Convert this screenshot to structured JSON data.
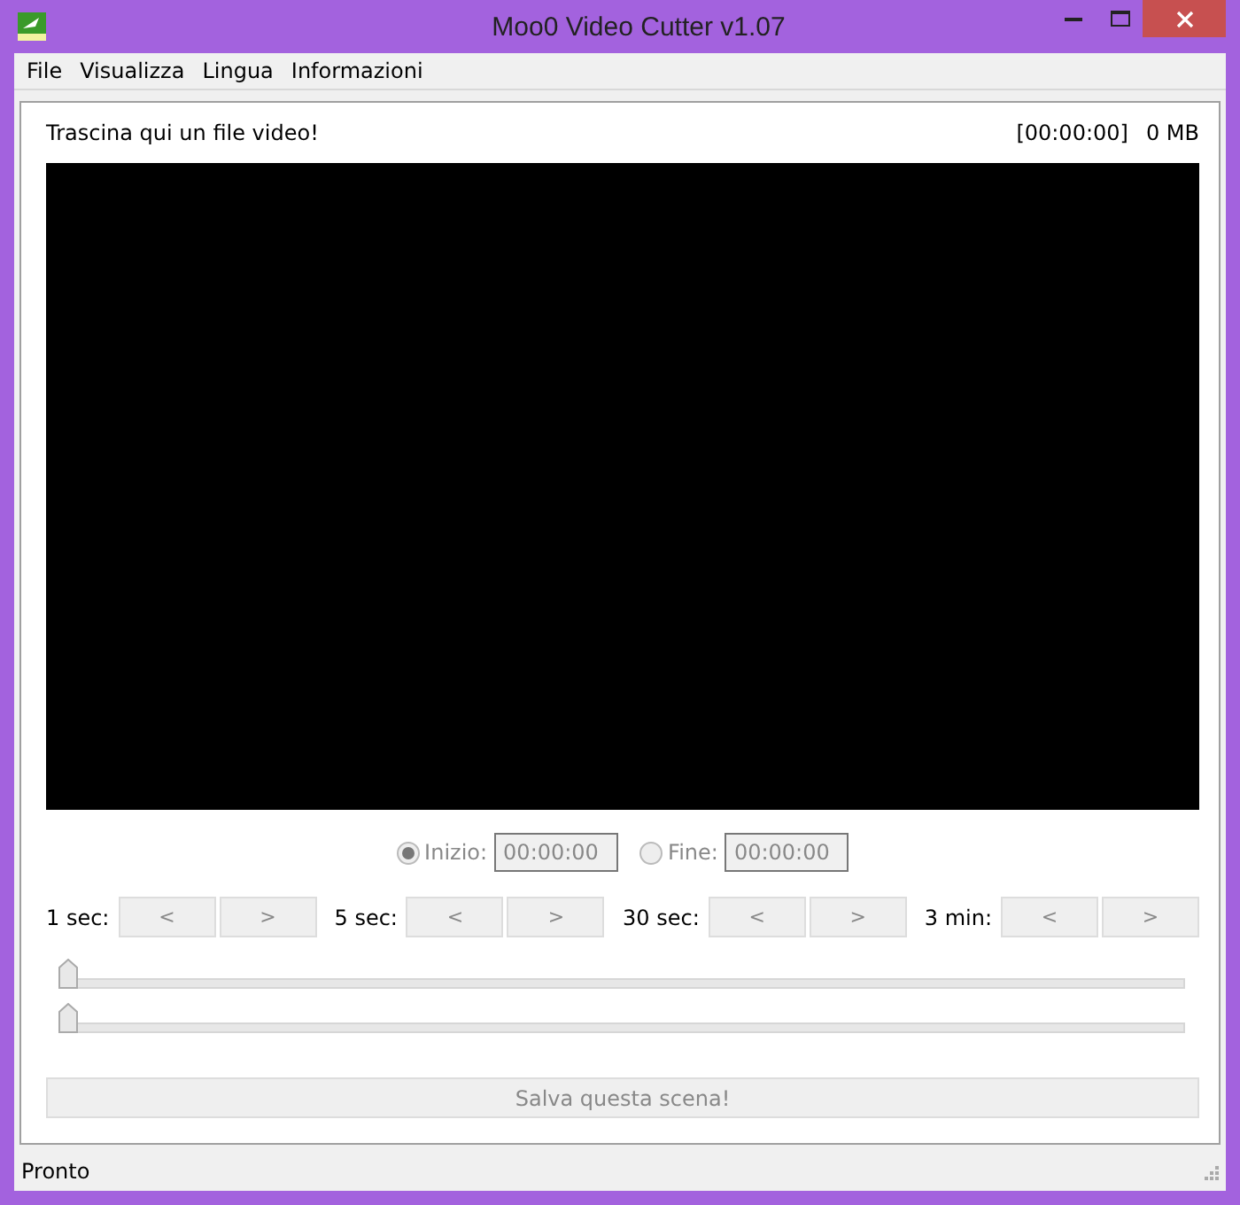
{
  "window": {
    "title": "Moo0 Video Cutter v1.07"
  },
  "menu": [
    "File",
    "Visualizza",
    "Lingua",
    "Informazioni"
  ],
  "header": {
    "hint": "Trascina qui un file video!",
    "duration": "[00:00:00]",
    "size": "0 MB"
  },
  "markers": [
    {
      "label": "Inizio:",
      "value": "00:00:00",
      "selected": true
    },
    {
      "label": "Fine:",
      "value": "00:00:00",
      "selected": false
    }
  ],
  "steps": [
    {
      "label": "1 sec:",
      "back": "<",
      "forward": ">",
      "disabled": true
    },
    {
      "label": "5 sec:",
      "back": "<",
      "forward": ">",
      "disabled": true
    },
    {
      "label": "30 sec:",
      "back": "<",
      "forward": ">",
      "disabled": true
    },
    {
      "label": "3 min:",
      "back": "<",
      "forward": ">",
      "disabled": true
    }
  ],
  "sliders": [
    {
      "level": 0
    },
    {
      "level": 0
    }
  ],
  "save_button": {
    "label": "Salva questa scena!",
    "disabled": true
  },
  "status_bar": "Pronto"
}
